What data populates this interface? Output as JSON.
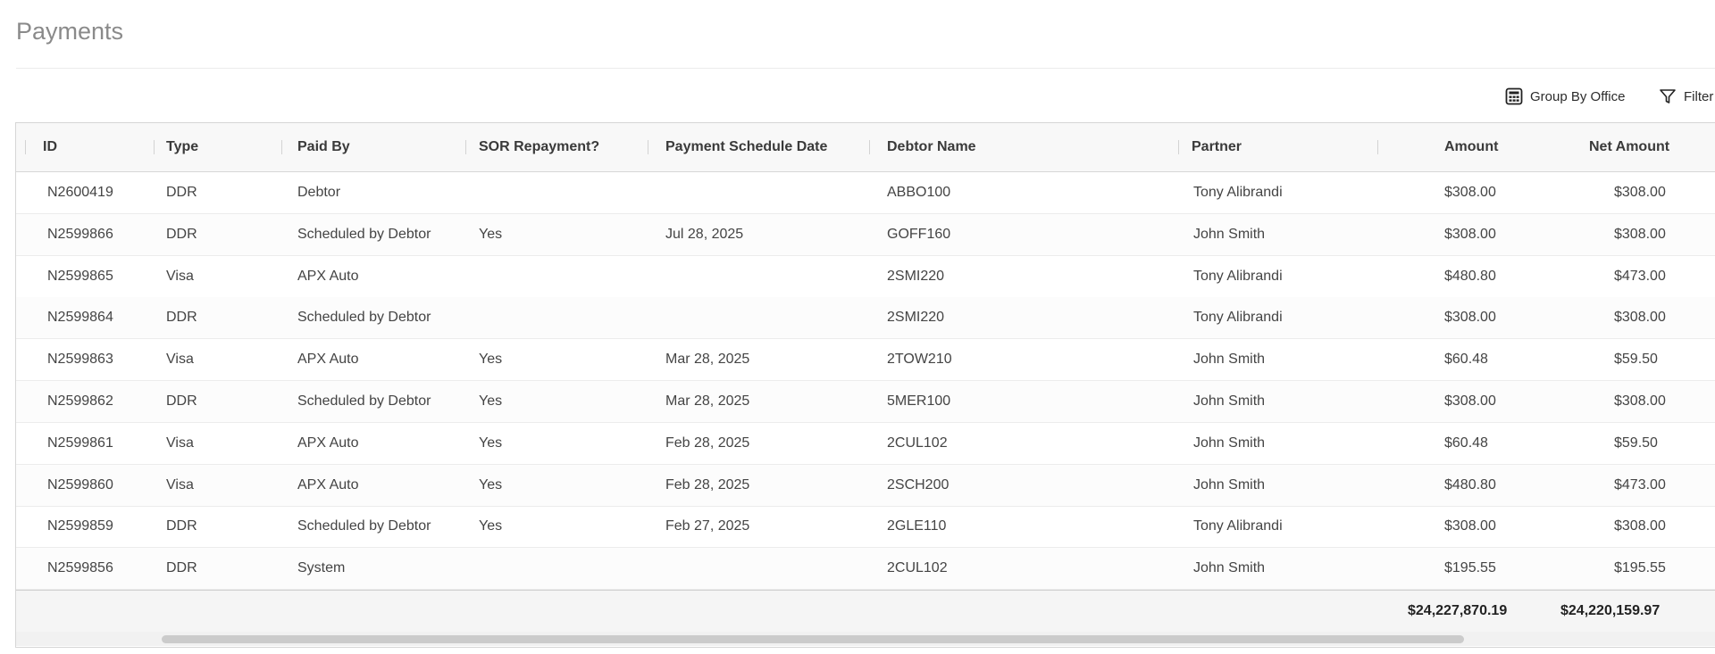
{
  "page": {
    "title": "Payments"
  },
  "toolbar": {
    "group_by_label": "Group By Office",
    "filter_label": "Filter"
  },
  "table": {
    "columns": {
      "id": "ID",
      "type": "Type",
      "paid_by": "Paid By",
      "sor": "SOR Repayment?",
      "schedule": "Payment Schedule Date",
      "debtor": "Debtor Name",
      "partner": "Partner",
      "amount": "Amount",
      "net": "Net Amount"
    },
    "rows": [
      {
        "id": "N2600419",
        "type": "DDR",
        "paid_by": "Debtor",
        "sor": "",
        "schedule": "",
        "debtor": "ABBO100",
        "partner": "Tony Alibrandi",
        "amount": "$308.00",
        "net": "$308.00"
      },
      {
        "id": "N2599866",
        "type": "DDR",
        "paid_by": "Scheduled by Debtor",
        "sor": "Yes",
        "schedule": "Jul 28, 2025",
        "debtor": "GOFF160",
        "partner": "John Smith",
        "amount": "$308.00",
        "net": "$308.00"
      },
      {
        "id": "N2599865",
        "type": "Visa",
        "paid_by": "APX Auto",
        "sor": "",
        "schedule": "",
        "debtor": "2SMI220",
        "partner": "Tony Alibrandi",
        "amount": "$480.80",
        "net": "$473.00"
      },
      {
        "id": "N2599864",
        "type": "DDR",
        "paid_by": "Scheduled by Debtor",
        "sor": "",
        "schedule": "",
        "debtor": "2SMI220",
        "partner": "Tony Alibrandi",
        "amount": "$308.00",
        "net": "$308.00"
      },
      {
        "id": "N2599863",
        "type": "Visa",
        "paid_by": "APX Auto",
        "sor": "Yes",
        "schedule": "Mar 28, 2025",
        "debtor": "2TOW210",
        "partner": "John Smith",
        "amount": "$60.48",
        "net": "$59.50"
      },
      {
        "id": "N2599862",
        "type": "DDR",
        "paid_by": "Scheduled by Debtor",
        "sor": "Yes",
        "schedule": "Mar 28, 2025",
        "debtor": "5MER100",
        "partner": "John Smith",
        "amount": "$308.00",
        "net": "$308.00"
      },
      {
        "id": "N2599861",
        "type": "Visa",
        "paid_by": "APX Auto",
        "sor": "Yes",
        "schedule": "Feb 28, 2025",
        "debtor": "2CUL102",
        "partner": "John Smith",
        "amount": "$60.48",
        "net": "$59.50"
      },
      {
        "id": "N2599860",
        "type": "Visa",
        "paid_by": "APX Auto",
        "sor": "Yes",
        "schedule": "Feb 28, 2025",
        "debtor": "2SCH200",
        "partner": "John Smith",
        "amount": "$480.80",
        "net": "$473.00"
      },
      {
        "id": "N2599859",
        "type": "DDR",
        "paid_by": "Scheduled by Debtor",
        "sor": "Yes",
        "schedule": "Feb 27, 2025",
        "debtor": "2GLE110",
        "partner": "Tony Alibrandi",
        "amount": "$308.00",
        "net": "$308.00"
      },
      {
        "id": "N2599856",
        "type": "DDR",
        "paid_by": "System",
        "sor": "",
        "schedule": "",
        "debtor": "2CUL102",
        "partner": "John Smith",
        "amount": "$195.55",
        "net": "$195.55"
      }
    ],
    "totals": {
      "amount": "$24,227,870.19",
      "net": "$24,220,159.97"
    }
  }
}
